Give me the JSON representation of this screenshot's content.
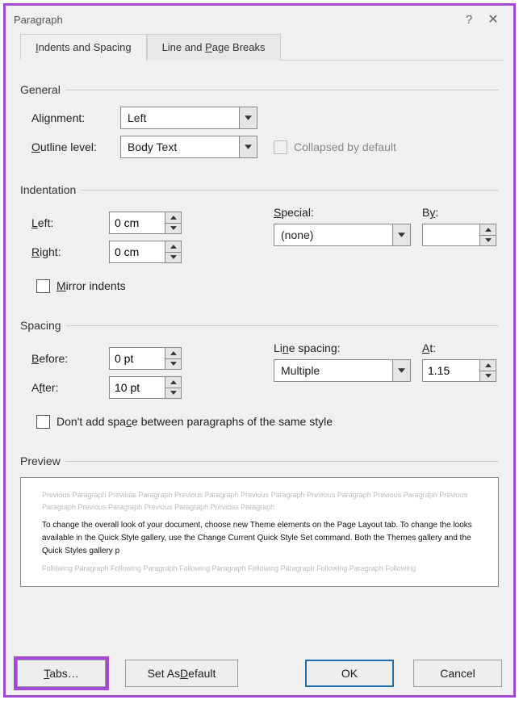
{
  "title": "Paragraph",
  "tabs": {
    "indents": "Indents and Spacing",
    "breaks": "Line and Page Breaks"
  },
  "general": {
    "header": "General",
    "alignment_label": "Alignment:",
    "alignment_value": "Left",
    "outline_label": "Outline level:",
    "outline_value": "Body Text",
    "collapsed_label": "Collapsed by default"
  },
  "indent": {
    "header": "Indentation",
    "left_label": "Left:",
    "left_value": "0 cm",
    "right_label": "Right:",
    "right_value": "0 cm",
    "special_label": "Special:",
    "special_value": "(none)",
    "by_label": "By:",
    "by_value": "",
    "mirror_label": "Mirror indents"
  },
  "spacing": {
    "header": "Spacing",
    "before_label": "Before:",
    "before_value": "0 pt",
    "after_label": "After:",
    "after_value": "10 pt",
    "linespacing_label": "Line spacing:",
    "linespacing_value": "Multiple",
    "at_label": "At:",
    "at_value": "1.15",
    "nospace_label": "Don't add space between paragraphs of the same style"
  },
  "preview": {
    "header": "Preview",
    "prev": "Previous Paragraph Previous Paragraph Previous Paragraph Previous Paragraph Previous Paragraph Previous Paragraph Previous Paragraph Previous Paragraph Previous Paragraph Previous Paragraph",
    "sample": "To change the overall look of your document, choose new Theme elements on the Page Layout tab. To change the looks available in the Quick Style gallery, use the Change Current Quick Style Set command. Both the Themes gallery and the Quick Styles gallery p",
    "follow": "Following Paragraph Following Paragraph Following Paragraph Following Paragraph Following Paragraph Following"
  },
  "footer": {
    "tabs": "Tabs…",
    "default": "Set As Default",
    "ok": "OK",
    "cancel": "Cancel"
  }
}
